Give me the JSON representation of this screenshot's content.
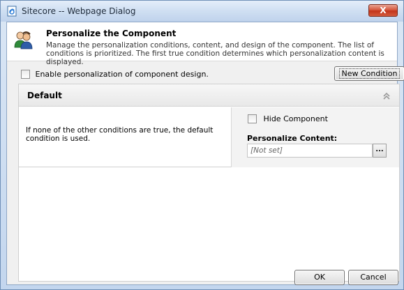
{
  "window": {
    "title": "Sitecore -- Webpage Dialog",
    "close_label": "X",
    "icon": "ie-page-icon"
  },
  "header": {
    "icon": "users-icon",
    "title": "Personalize the Component",
    "description": "Manage the personalization conditions, content, and design of the component. The list of conditions is prioritized. The first true condition determines which personalization content is displayed."
  },
  "enable": {
    "label": "Enable personalization of component design.",
    "checked": false
  },
  "new_condition_label": "New Condition",
  "default_condition": {
    "title": "Default",
    "collapse_icon": "chevron-up-double-icon",
    "description": "If none of the other conditions are true, the default condition is used.",
    "hide_component_label": "Hide Component",
    "hide_component_checked": false,
    "personalize_content_label": "Personalize Content:",
    "content_value": "[Not set]",
    "browse_label": "..."
  },
  "buttons": {
    "ok": "OK",
    "cancel": "Cancel"
  },
  "colors": {
    "title_bar": "#cfdff2",
    "close_button": "#c2341b",
    "panel_header": "#e8e8e8"
  }
}
